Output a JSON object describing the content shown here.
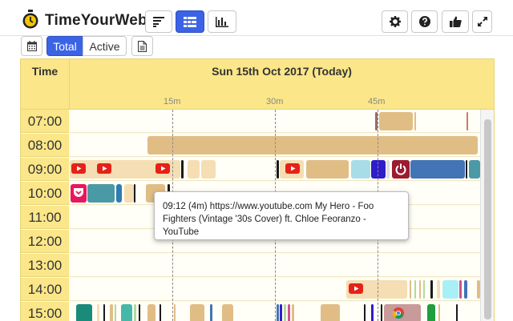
{
  "app": {
    "brand": "TimeYourWeb"
  },
  "header_buttons": {
    "view_sort": "sort-bars-icon",
    "view_timeline": "timeline-icon",
    "view_chart": "bar-chart-icon",
    "settings": "gear-icon",
    "help": "question-icon",
    "like": "thumbs-up-icon",
    "expand": "expand-icon"
  },
  "subtoolbar": {
    "calendar": "calendar-icon",
    "total_label": "Total",
    "active_label": "Active",
    "report": "document-icon"
  },
  "table": {
    "time_header": "Time",
    "date_header": "Sun 15th Oct 2017 (Today)",
    "ticks": [
      "15m",
      "30m",
      "45m"
    ],
    "rows": [
      "07:00",
      "08:00",
      "09:00",
      "10:00",
      "11:00",
      "12:00",
      "13:00",
      "14:00",
      "15:00"
    ]
  },
  "tooltip": {
    "text": "09:12 (4m) https://www.youtube.com My Hero - Foo Fighters (Vintage '30s Cover) ft. Chloe Feoranzo - YouTube"
  },
  "colors": {
    "accent": "#3b63e6",
    "header_bg": "#fbe689",
    "row_label_bg": "#fbe689",
    "segment_tan": "#e1bd86",
    "youtube_red": "#e62117"
  }
}
